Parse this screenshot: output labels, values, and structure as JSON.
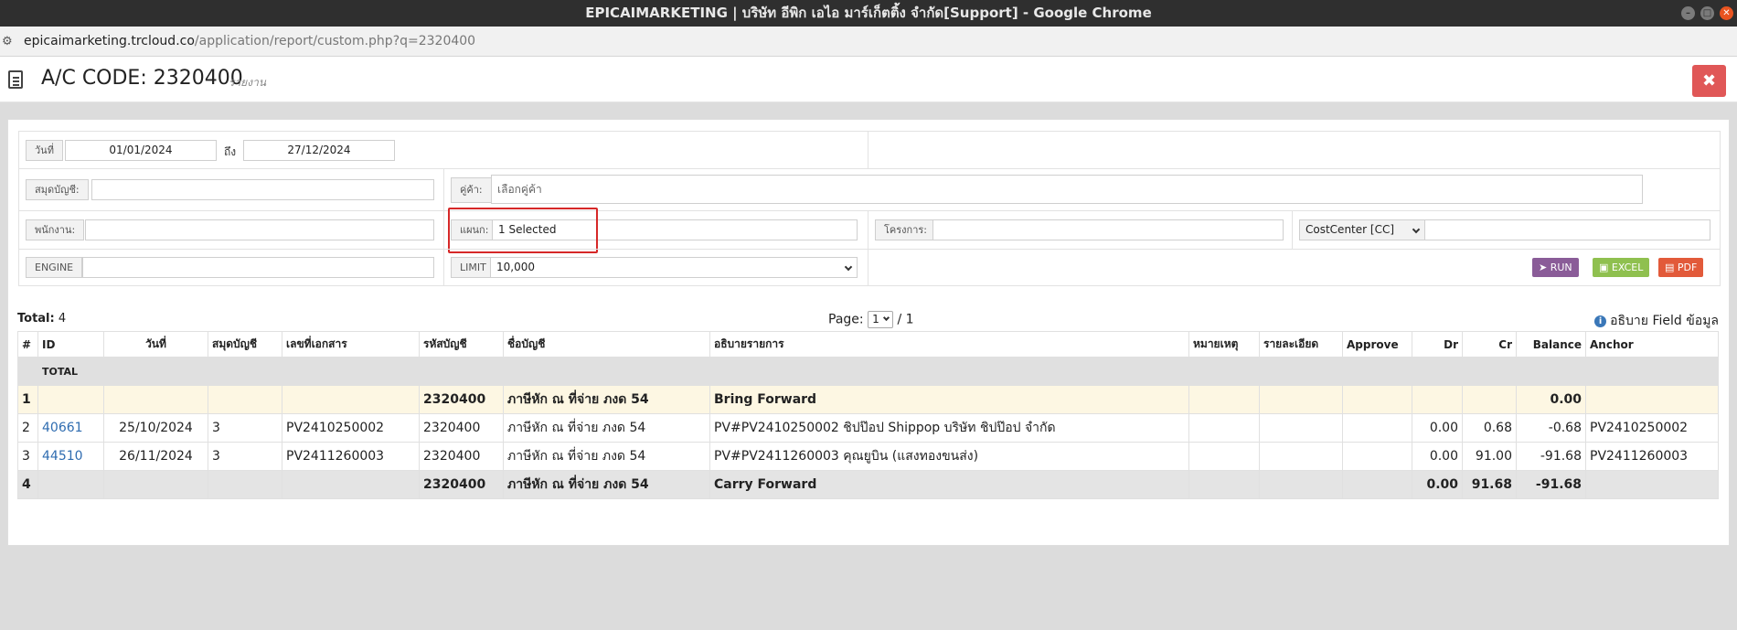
{
  "browser": {
    "window_title": "EPICAIMARKETING | บริษัท อีพิก เอไอ มาร์เก็ตติ้ง จำกัด[Support] - Google Chrome",
    "url_host": "epicaimarketing.trcloud.co",
    "url_path": "/application/report/custom.php?q=2320400"
  },
  "header": {
    "title": "A/C CODE: 2320400",
    "subtitle": "รายงาน",
    "close_symbol": "✖"
  },
  "filters": {
    "date_label": "วันที่",
    "date_from": "01/01/2024",
    "date_to_label": "ถึง",
    "date_to": "27/12/2024",
    "journal_label": "สมุดบัญชี:",
    "journal_value": "",
    "partner_label": "คู่ค้า:",
    "partner_placeholder": "เลือกคู่ค้า",
    "employee_label": "พนักงาน:",
    "employee_value": "",
    "department_label": "แผนก:",
    "department_value": "1 Selected",
    "project_label": "โครงการ:",
    "project_value": "",
    "costcenter_select": "CostCenter [CC]",
    "costcenter_value": "",
    "engine_label": "ENGINE",
    "engine_value": "",
    "limit_label": "LIMIT",
    "limit_value": "10,000",
    "run_label": "RUN",
    "excel_label": "EXCEL",
    "pdf_label": "PDF"
  },
  "summary": {
    "total_label": "Total:",
    "total_value": "4",
    "page_label": "Page:",
    "page_current": "1",
    "page_total": "/ 1",
    "info_label": "อธิบาย Field ข้อมูล"
  },
  "table": {
    "columns": [
      "#",
      "ID",
      "วันที่",
      "สมุดบัญชี",
      "เลขที่เอกสาร",
      "รหัสบัญชี",
      "ชื่อบัญชี",
      "อธิบายรายการ",
      "หมายเหตุ",
      "รายละเอียด",
      "Approve",
      "Dr",
      "Cr",
      "Balance",
      "Anchor"
    ],
    "total_row_label": "TOTAL",
    "rows": [
      {
        "no": "1",
        "id": "",
        "date": "",
        "journal": "",
        "doc": "",
        "acc": "2320400",
        "acc_name": "ภาษีหัก ณ ที่จ่าย ภงด 54",
        "desc": "Bring Forward",
        "note": "",
        "detail": "",
        "approve": "",
        "dr": "",
        "cr": "",
        "balance": "0.00",
        "anchor": ""
      },
      {
        "no": "2",
        "id": "40661",
        "date": "25/10/2024",
        "journal": "3",
        "doc": "PV2410250002",
        "acc": "2320400",
        "acc_name": "ภาษีหัก ณ ที่จ่าย ภงด 54",
        "desc": "PV#PV2410250002 ชิปป๊อป Shippop บริษัท ชิปป๊อป จำกัด",
        "note": "",
        "detail": "",
        "approve": "",
        "dr": "0.00",
        "cr": "0.68",
        "balance": "-0.68",
        "anchor": "PV2410250002"
      },
      {
        "no": "3",
        "id": "44510",
        "date": "26/11/2024",
        "journal": "3",
        "doc": "PV2411260003",
        "acc": "2320400",
        "acc_name": "ภาษีหัก ณ ที่จ่าย ภงด 54",
        "desc": "PV#PV2411260003 คุณยูบิน (แสงทองขนส่ง)",
        "note": "",
        "detail": "",
        "approve": "",
        "dr": "0.00",
        "cr": "91.00",
        "balance": "-91.68",
        "anchor": "PV2411260003"
      },
      {
        "no": "4",
        "id": "",
        "date": "",
        "journal": "",
        "doc": "",
        "acc": "2320400",
        "acc_name": "ภาษีหัก ณ ที่จ่าย ภงด 54",
        "desc": "Carry Forward",
        "note": "",
        "detail": "",
        "approve": "",
        "dr": "0.00",
        "cr": "91.68",
        "balance": "-91.68",
        "anchor": ""
      }
    ]
  },
  "colors": {
    "close_button": "#e05757",
    "highlight_box": "#d62828",
    "run_button": "#8a5c98",
    "excel_button": "#8fc04f",
    "pdf_button": "#e25a3a",
    "link": "#2f6cb0",
    "bring_forward_row": "#fdf7e3"
  }
}
